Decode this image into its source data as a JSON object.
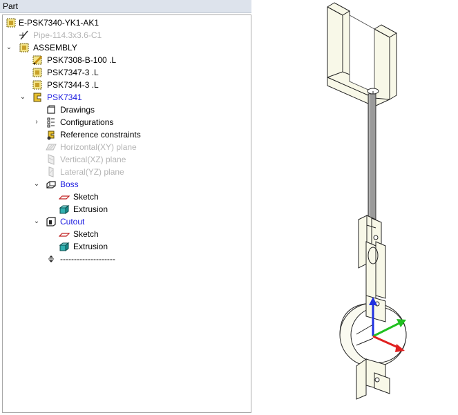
{
  "panel": {
    "title": "Part"
  },
  "tree": {
    "root": {
      "label": "E-PSK7340-YK1-AK1",
      "icon": "assembly-icon"
    },
    "pipe": {
      "label": "Pipe-114.3x3.6-C1",
      "icon": "pipe-icon"
    },
    "assembly": {
      "label": "ASSEMBLY",
      "icon": "assembly-icon",
      "expanded": true
    },
    "part1": {
      "label": "PSK7308-B-100 .L",
      "icon": "edited-part-icon"
    },
    "part2": {
      "label": "PSK7347-3 .L",
      "icon": "assembly-icon"
    },
    "part3": {
      "label": "PSK7344-3 .L",
      "icon": "assembly-icon"
    },
    "psk7341": {
      "label": "PSK7341",
      "icon": "part-icon",
      "expanded": true
    },
    "drawings": {
      "label": "Drawings",
      "icon": "drawings-icon"
    },
    "configurations": {
      "label": "Configurations",
      "icon": "configurations-icon",
      "expanded": false
    },
    "refcons": {
      "label": "Reference constraints",
      "icon": "reference-constraints-icon"
    },
    "plane_xy": {
      "label": "Horizontal(XY) plane",
      "icon": "plane-icon"
    },
    "plane_xz": {
      "label": "Vertical(XZ) plane",
      "icon": "plane-icon"
    },
    "plane_yz": {
      "label": "Lateral(YZ) plane",
      "icon": "plane-icon"
    },
    "boss": {
      "label": "Boss",
      "icon": "boss-icon",
      "expanded": true
    },
    "boss_sketch": {
      "label": "Sketch",
      "icon": "sketch-icon"
    },
    "boss_extrusion": {
      "label": "Extrusion",
      "icon": "extrusion-icon"
    },
    "cutout": {
      "label": "Cutout",
      "icon": "cutout-icon",
      "expanded": true
    },
    "cutout_sketch": {
      "label": "Sketch",
      "icon": "sketch-icon"
    },
    "cutout_extrusion": {
      "label": "Extrusion",
      "icon": "extrusion-icon"
    },
    "end_marker": {
      "label": "--------------------",
      "icon": "end-marker-icon"
    }
  },
  "colors": {
    "active_feature": "#1a1ae0",
    "suppressed": "#b4b4b4",
    "axis_x": "#e02020",
    "axis_y": "#20c020",
    "axis_z": "#2030e0",
    "model_face": "#f8f8e8"
  }
}
